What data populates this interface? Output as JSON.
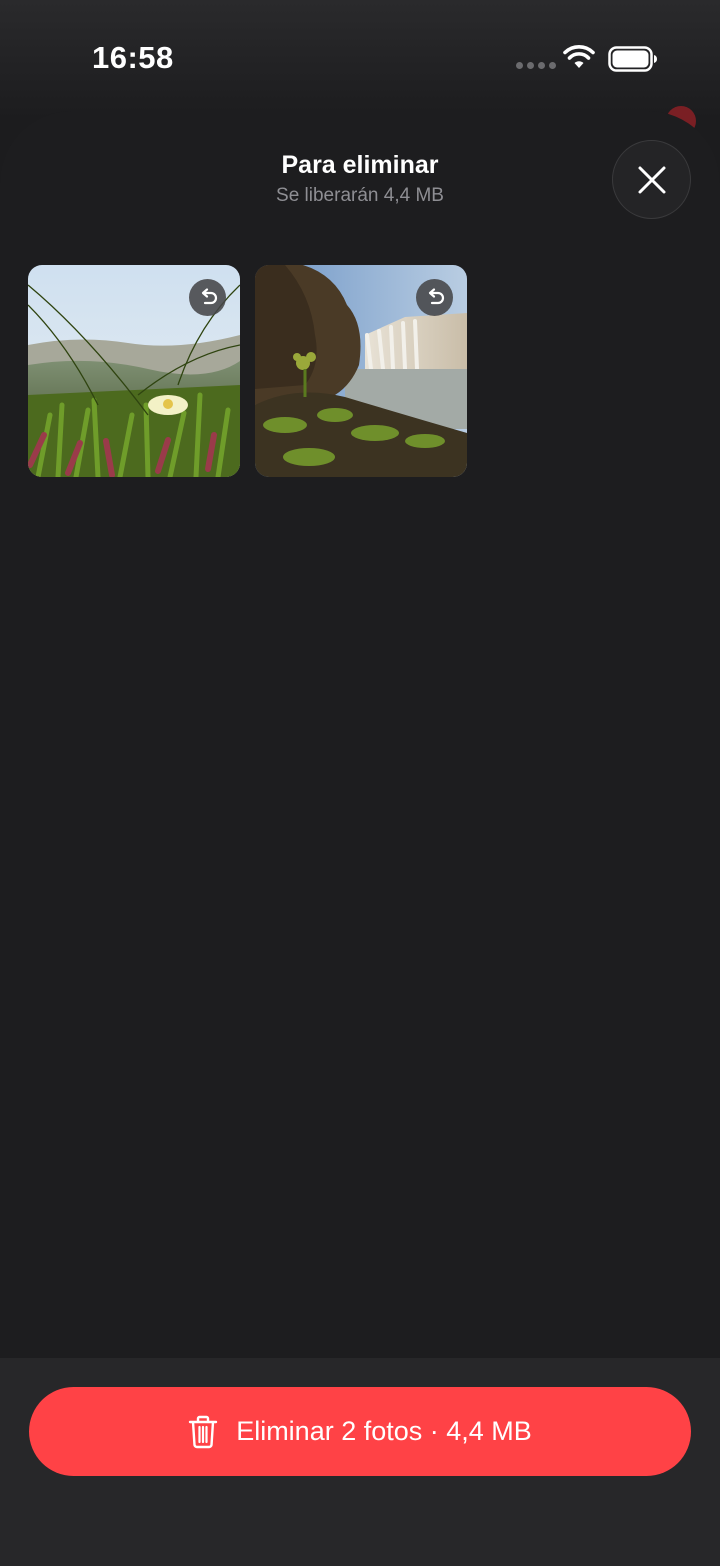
{
  "status_bar": {
    "time": "16:58",
    "icons": [
      "signal-dots-icon",
      "wifi-icon",
      "battery-icon"
    ]
  },
  "sheet": {
    "title": "Para eliminar",
    "subtitle": "Se liberarán 4,4 MB",
    "close_icon": "close-icon"
  },
  "photos": [
    {
      "subject": "flowers-field",
      "action_icon": "undo-icon"
    },
    {
      "subject": "waterfall-cliff",
      "action_icon": "undo-icon"
    }
  ],
  "delete_button": {
    "icon": "trash-icon",
    "label": "Eliminar 2 fotos · 4,4 MB"
  },
  "colors": {
    "accent_red": "#ff4246",
    "sheet_bg": "#1d1d1f",
    "secondary_text": "#8e8e93"
  }
}
